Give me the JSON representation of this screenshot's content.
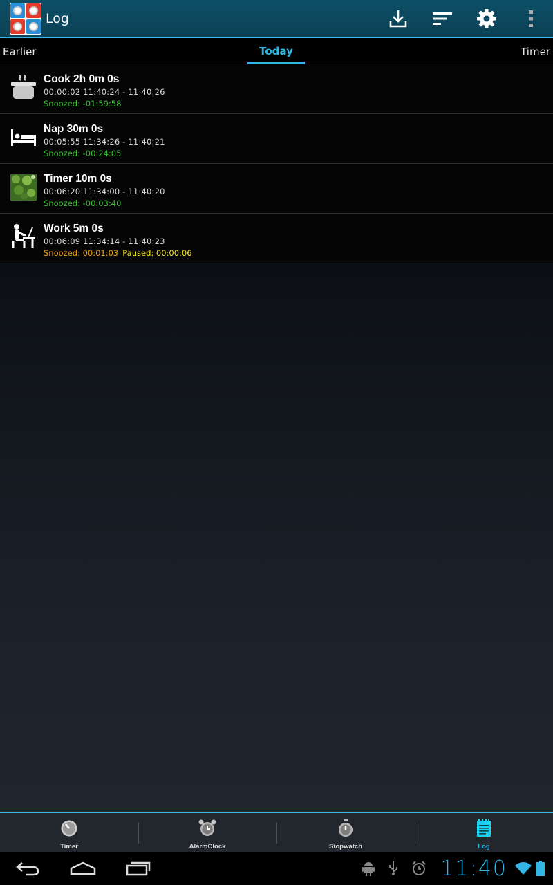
{
  "app": {
    "title": "Log"
  },
  "actions": {
    "export_icon": "download-icon",
    "sort_icon": "sort-icon",
    "settings_icon": "gear-icon",
    "overflow_icon": "overflow-menu-icon"
  },
  "tabs": {
    "earlier": "Earlier",
    "today": "Today",
    "timer": "Timer"
  },
  "log": [
    {
      "icon": "cooking-pot-icon",
      "title": "Cook 2h 0m 0s",
      "times": "00:00:02  11:40:24 - 11:40:26",
      "snoozed": "Snoozed:  -01:59:58",
      "paused": ""
    },
    {
      "icon": "bed-icon",
      "title": "Nap 30m 0s",
      "times": "00:05:55  11:34:26 - 11:40:21",
      "snoozed": "Snoozed:  -00:24:05",
      "paused": ""
    },
    {
      "icon": "leaf-photo-icon",
      "title": "Timer 10m 0s",
      "times": "00:06:20  11:34:00 - 11:40:20",
      "snoozed": "Snoozed:  -00:03:40",
      "paused": ""
    },
    {
      "icon": "desk-worker-icon",
      "title": "Work 5m 0s",
      "times": "00:06:09  11:34:14 - 11:40:23",
      "snoozed": "Snoozed: 00:01:03",
      "paused": "Paused: 00:00:06"
    }
  ],
  "bottom_nav": [
    {
      "label": "Timer",
      "icon": "timer-icon",
      "active": false
    },
    {
      "label": "AlarmClock",
      "icon": "alarm-clock-icon",
      "active": false
    },
    {
      "label": "Stopwatch",
      "icon": "stopwatch-icon",
      "active": false
    },
    {
      "label": "Log",
      "icon": "log-notepad-icon",
      "active": true
    }
  ],
  "system_bar": {
    "clock": "11:40",
    "accent": "#33b5e5"
  },
  "colors": {
    "accent": "#33b5e5",
    "snoozed_green": "#35c12d",
    "snoozed_orange": "#f0a10a",
    "paused_yellow": "#f4e51a"
  }
}
